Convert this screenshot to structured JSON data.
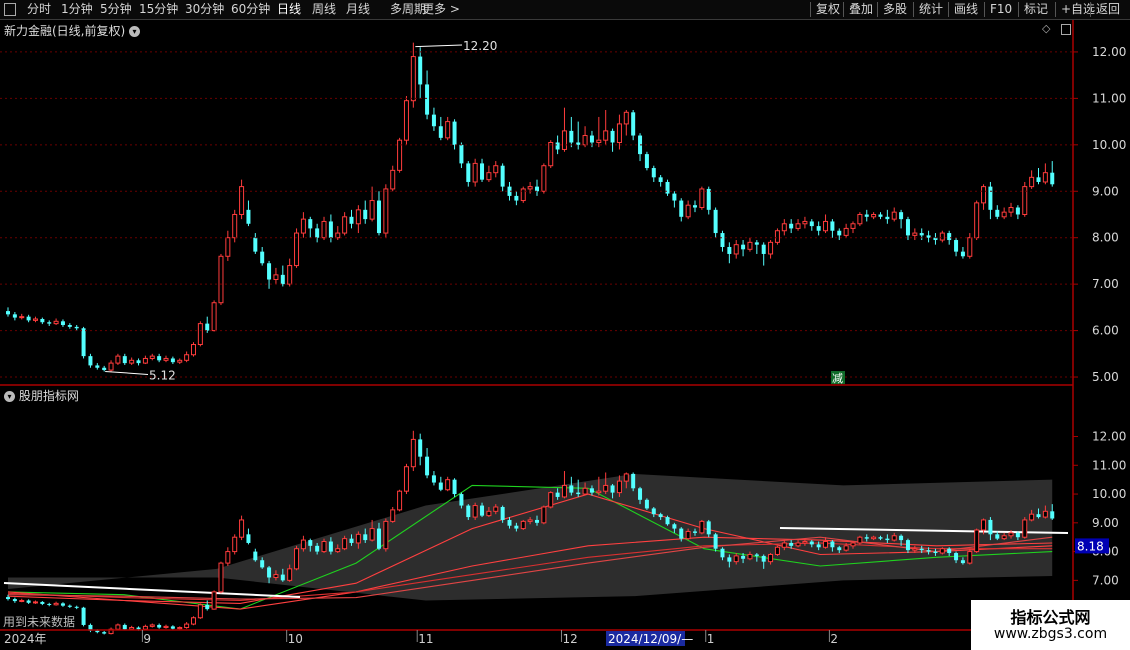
{
  "toolbar": {
    "left_items": [
      "分时",
      "1分钟",
      "5分钟",
      "15分钟",
      "30分钟",
      "60分钟",
      "日线",
      "周线",
      "月线",
      "多周期",
      "更多 >"
    ],
    "right_items": [
      "复权",
      "叠加",
      "多股",
      "统计",
      "画线",
      "F10",
      "标记",
      "+自选",
      "返回"
    ]
  },
  "price_panel": {
    "title": "新力金融(日线,前复权)",
    "high_label": "12.20",
    "low_label": "5.12",
    "jian_badge": "减"
  },
  "indicator_panel": {
    "title": "股朋指标网",
    "future_label": "用到未来数据",
    "current_value": "8.18"
  },
  "x_axis": {
    "labels": [
      {
        "text": "2024年",
        "index": 0
      },
      {
        "text": "9",
        "index": 20
      },
      {
        "text": "10",
        "index": 41
      },
      {
        "text": "11",
        "index": 60
      },
      {
        "text": "12",
        "index": 81
      },
      {
        "text": "1",
        "index": 102
      },
      {
        "text": "2",
        "index": 120
      }
    ],
    "cursor_label": "2024/12/09/—"
  },
  "watermark": {
    "line1": "指标公式网",
    "line2": "www.zbgs3.com"
  },
  "colors": {
    "up": "#ff3c3c",
    "down": "#54ffff",
    "axis": "#aa0000",
    "green_line": "#1fd21f",
    "white_line": "#ffffff"
  },
  "chart_data": [
    {
      "type": "candlestick",
      "title": "新力金融(日线,前复权)",
      "ylim": [
        4.85,
        12.3
      ],
      "yticks": [
        5.0,
        6.0,
        7.0,
        8.0,
        9.0,
        10.0,
        11.0,
        12.0
      ],
      "annotations": [
        {
          "text": "12.20",
          "value": 12.2
        },
        {
          "text": "5.12",
          "value": 5.12
        }
      ],
      "candles": [
        [
          6.42,
          6.35,
          6.5,
          6.3
        ],
        [
          6.35,
          6.28,
          6.4,
          6.22
        ],
        [
          6.28,
          6.3,
          6.36,
          6.24
        ],
        [
          6.3,
          6.22,
          6.34,
          6.18
        ],
        [
          6.22,
          6.25,
          6.3,
          6.18
        ],
        [
          6.25,
          6.18,
          6.28,
          6.14
        ],
        [
          6.18,
          6.15,
          6.22,
          6.1
        ],
        [
          6.15,
          6.2,
          6.26,
          6.12
        ],
        [
          6.2,
          6.12,
          6.24,
          6.08
        ],
        [
          6.12,
          6.08,
          6.16,
          6.04
        ],
        [
          6.08,
          6.05,
          6.12,
          6.0
        ],
        [
          6.05,
          5.45,
          6.08,
          5.4
        ],
        [
          5.45,
          5.25,
          5.5,
          5.2
        ],
        [
          5.25,
          5.2,
          5.3,
          5.16
        ],
        [
          5.2,
          5.15,
          5.24,
          5.12
        ],
        [
          5.15,
          5.3,
          5.36,
          5.12
        ],
        [
          5.3,
          5.45,
          5.5,
          5.26
        ],
        [
          5.45,
          5.3,
          5.5,
          5.26
        ],
        [
          5.3,
          5.36,
          5.42,
          5.26
        ],
        [
          5.36,
          5.3,
          5.4,
          5.25
        ],
        [
          5.3,
          5.4,
          5.46,
          5.28
        ],
        [
          5.4,
          5.45,
          5.5,
          5.36
        ],
        [
          5.45,
          5.36,
          5.5,
          5.32
        ],
        [
          5.36,
          5.4,
          5.46,
          5.32
        ],
        [
          5.4,
          5.32,
          5.44,
          5.28
        ],
        [
          5.32,
          5.36,
          5.4,
          5.28
        ],
        [
          5.36,
          5.48,
          5.55,
          5.32
        ],
        [
          5.48,
          5.7,
          5.75,
          5.44
        ],
        [
          5.7,
          6.15,
          6.2,
          5.66
        ],
        [
          6.15,
          6.0,
          6.3,
          5.95
        ],
        [
          6.0,
          6.6,
          6.65,
          5.98
        ],
        [
          6.6,
          7.6,
          7.65,
          6.55
        ],
        [
          7.6,
          8.0,
          8.15,
          7.5
        ],
        [
          8.0,
          8.5,
          8.6,
          7.9
        ],
        [
          8.5,
          9.1,
          9.25,
          8.4
        ],
        [
          8.6,
          8.3,
          8.8,
          8.25
        ],
        [
          8.0,
          7.7,
          8.1,
          7.65
        ],
        [
          7.7,
          7.45,
          7.8,
          7.4
        ],
        [
          7.45,
          7.1,
          7.5,
          6.9
        ],
        [
          7.1,
          7.2,
          7.35,
          7.0
        ],
        [
          7.2,
          7.0,
          7.4,
          6.95
        ],
        [
          7.0,
          7.4,
          7.55,
          6.95
        ],
        [
          7.4,
          8.1,
          8.2,
          7.35
        ],
        [
          8.1,
          8.4,
          8.55,
          8.0
        ],
        [
          8.4,
          8.2,
          8.45,
          8.0
        ],
        [
          8.2,
          8.0,
          8.3,
          7.9
        ],
        [
          8.0,
          8.35,
          8.45,
          7.95
        ],
        [
          8.35,
          8.0,
          8.5,
          7.9
        ],
        [
          8.0,
          8.1,
          8.25,
          7.95
        ],
        [
          8.1,
          8.45,
          8.55,
          8.05
        ],
        [
          8.45,
          8.3,
          8.6,
          8.2
        ],
        [
          8.3,
          8.6,
          8.7,
          8.1
        ],
        [
          8.6,
          8.4,
          8.8,
          8.3
        ],
        [
          8.4,
          8.8,
          9.1,
          8.35
        ],
        [
          8.8,
          8.1,
          9.0,
          8.05
        ],
        [
          8.1,
          9.05,
          9.15,
          8.0
        ],
        [
          9.05,
          9.45,
          9.55,
          9.0
        ],
        [
          9.45,
          10.1,
          10.15,
          9.4
        ],
        [
          10.1,
          10.95,
          11.05,
          10.0
        ],
        [
          10.95,
          11.9,
          12.2,
          10.8
        ],
        [
          11.9,
          11.3,
          12.1,
          11.0
        ],
        [
          11.3,
          10.65,
          11.6,
          10.55
        ],
        [
          10.65,
          10.4,
          10.8,
          10.3
        ],
        [
          10.4,
          10.15,
          10.6,
          10.1
        ],
        [
          10.15,
          10.5,
          10.6,
          10.1
        ],
        [
          10.5,
          10.0,
          10.55,
          9.9
        ],
        [
          10.0,
          9.6,
          10.05,
          9.5
        ],
        [
          9.6,
          9.2,
          9.65,
          9.1
        ],
        [
          9.2,
          9.6,
          9.7,
          9.1
        ],
        [
          9.6,
          9.25,
          9.7,
          9.2
        ],
        [
          9.25,
          9.4,
          9.55,
          9.2
        ],
        [
          9.4,
          9.55,
          9.65,
          9.3
        ],
        [
          9.55,
          9.1,
          9.6,
          9.0
        ],
        [
          9.1,
          8.9,
          9.2,
          8.8
        ],
        [
          8.9,
          8.8,
          9.0,
          8.7
        ],
        [
          8.8,
          9.05,
          9.1,
          8.75
        ],
        [
          9.05,
          9.1,
          9.2,
          8.95
        ],
        [
          9.1,
          9.0,
          9.25,
          8.9
        ],
        [
          9.0,
          9.55,
          9.6,
          8.95
        ],
        [
          9.55,
          10.05,
          10.1,
          9.5
        ],
        [
          10.05,
          9.9,
          10.2,
          9.8
        ],
        [
          9.9,
          10.3,
          10.8,
          9.85
        ],
        [
          10.3,
          10.05,
          10.6,
          9.95
        ],
        [
          10.05,
          10.0,
          10.5,
          9.9
        ],
        [
          10.0,
          10.2,
          10.4,
          9.95
        ],
        [
          10.2,
          10.05,
          10.3,
          9.95
        ],
        [
          10.05,
          10.1,
          10.6,
          9.95
        ],
        [
          10.1,
          10.3,
          10.75,
          10.0
        ],
        [
          10.3,
          10.05,
          10.35,
          9.85
        ],
        [
          10.05,
          10.45,
          10.65,
          9.9
        ],
        [
          10.45,
          10.7,
          10.75,
          10.2
        ],
        [
          10.7,
          10.2,
          10.75,
          10.1
        ],
        [
          10.2,
          9.8,
          10.25,
          9.65
        ],
        [
          9.8,
          9.5,
          9.85,
          9.45
        ],
        [
          9.5,
          9.3,
          9.55,
          9.2
        ],
        [
          9.3,
          9.2,
          9.35,
          9.1
        ],
        [
          9.2,
          8.95,
          9.25,
          8.9
        ],
        [
          8.95,
          8.8,
          9.0,
          8.65
        ],
        [
          8.8,
          8.45,
          8.85,
          8.35
        ],
        [
          8.45,
          8.7,
          8.8,
          8.4
        ],
        [
          8.7,
          8.65,
          8.8,
          8.55
        ],
        [
          8.65,
          9.05,
          9.1,
          8.6
        ],
        [
          9.05,
          8.6,
          9.1,
          8.5
        ],
        [
          8.6,
          8.1,
          8.65,
          8.0
        ],
        [
          8.1,
          7.8,
          8.15,
          7.7
        ],
        [
          7.8,
          7.65,
          7.9,
          7.45
        ],
        [
          7.65,
          7.85,
          7.95,
          7.55
        ],
        [
          7.85,
          7.75,
          7.95,
          7.6
        ],
        [
          7.75,
          7.9,
          8.0,
          7.7
        ],
        [
          7.9,
          7.85,
          7.95,
          7.65
        ],
        [
          7.85,
          7.65,
          7.9,
          7.4
        ],
        [
          7.65,
          7.9,
          7.95,
          7.55
        ],
        [
          7.9,
          8.15,
          8.2,
          7.85
        ],
        [
          8.15,
          8.3,
          8.4,
          8.05
        ],
        [
          8.3,
          8.2,
          8.4,
          8.1
        ],
        [
          8.2,
          8.3,
          8.4,
          8.15
        ],
        [
          8.3,
          8.35,
          8.45,
          8.2
        ],
        [
          8.35,
          8.25,
          8.4,
          8.15
        ],
        [
          8.25,
          8.15,
          8.35,
          8.05
        ],
        [
          8.15,
          8.35,
          8.5,
          8.1
        ],
        [
          8.35,
          8.15,
          8.4,
          8.0
        ],
        [
          8.15,
          8.05,
          8.2,
          7.95
        ],
        [
          8.05,
          8.2,
          8.3,
          8.0
        ],
        [
          8.2,
          8.3,
          8.35,
          8.1
        ],
        [
          8.3,
          8.5,
          8.55,
          8.25
        ],
        [
          8.5,
          8.45,
          8.6,
          8.35
        ],
        [
          8.45,
          8.5,
          8.55,
          8.4
        ],
        [
          8.5,
          8.45,
          8.55,
          8.4
        ],
        [
          8.45,
          8.4,
          8.6,
          8.3
        ],
        [
          8.4,
          8.55,
          8.65,
          8.35
        ],
        [
          8.55,
          8.4,
          8.6,
          8.2
        ],
        [
          8.4,
          8.05,
          8.45,
          7.95
        ],
        [
          8.05,
          8.1,
          8.2,
          7.95
        ],
        [
          8.1,
          8.05,
          8.2,
          7.95
        ],
        [
          8.05,
          8.0,
          8.15,
          7.9
        ],
        [
          8.0,
          7.95,
          8.1,
          7.85
        ],
        [
          7.95,
          8.1,
          8.15,
          7.9
        ],
        [
          8.1,
          7.95,
          8.15,
          7.85
        ],
        [
          7.95,
          7.7,
          8.0,
          7.6
        ],
        [
          7.7,
          7.6,
          7.8,
          7.55
        ],
        [
          7.6,
          8.0,
          8.1,
          7.55
        ],
        [
          8.0,
          8.75,
          8.8,
          7.95
        ],
        [
          8.75,
          9.1,
          9.15,
          8.6
        ],
        [
          9.1,
          8.6,
          9.2,
          8.4
        ],
        [
          8.6,
          8.45,
          8.7,
          8.4
        ],
        [
          8.45,
          8.55,
          8.65,
          8.4
        ],
        [
          8.55,
          8.65,
          8.75,
          8.45
        ],
        [
          8.65,
          8.5,
          8.7,
          8.4
        ],
        [
          8.5,
          9.1,
          9.2,
          8.45
        ],
        [
          9.1,
          9.3,
          9.45,
          9.05
        ],
        [
          9.3,
          9.2,
          9.5,
          9.15
        ],
        [
          9.2,
          9.4,
          9.6,
          9.15
        ],
        [
          9.4,
          9.15,
          9.65,
          9.1
        ]
      ]
    },
    {
      "type": "candlestick",
      "title": "股朋指标网",
      "ylim": [
        5.9,
        13.2
      ],
      "yticks": [
        6.0,
        7.0,
        8.0,
        9.0,
        10.0,
        11.0,
        12.0
      ],
      "current_value": 8.18,
      "series": [
        {
          "type": "area",
          "lower": [
            7.1,
            7.1,
            6.3,
            6.45,
            7.0,
            7.15
          ],
          "upper": [
            6.7,
            7.4,
            9.6,
            10.7,
            10.3,
            10.5
          ]
        },
        {
          "type": "line",
          "values": [
            6.6,
            6.5,
            6.0,
            7.6,
            10.3,
            10.2,
            8.1,
            7.5,
            7.8,
            8.0
          ]
        },
        {
          "type": "line",
          "values": [
            6.45,
            6.3,
            6.2,
            6.9,
            8.8,
            10.0,
            8.8,
            7.9,
            8.0,
            8.2
          ]
        },
        {
          "type": "line",
          "values": [
            6.6,
            6.3,
            6.0,
            6.6,
            7.5,
            8.2,
            8.5,
            8.4,
            8.2,
            8.3
          ]
        },
        {
          "type": "line",
          "values": [
            6.55,
            6.4,
            6.3,
            6.6,
            7.2,
            7.8,
            8.2,
            8.3,
            8.1,
            8.1
          ]
        },
        {
          "type": "line",
          "values": [
            6.5,
            6.45,
            6.35,
            6.4,
            7.0,
            7.6,
            8.15,
            8.5,
            8.0,
            8.5
          ]
        }
      ]
    }
  ]
}
